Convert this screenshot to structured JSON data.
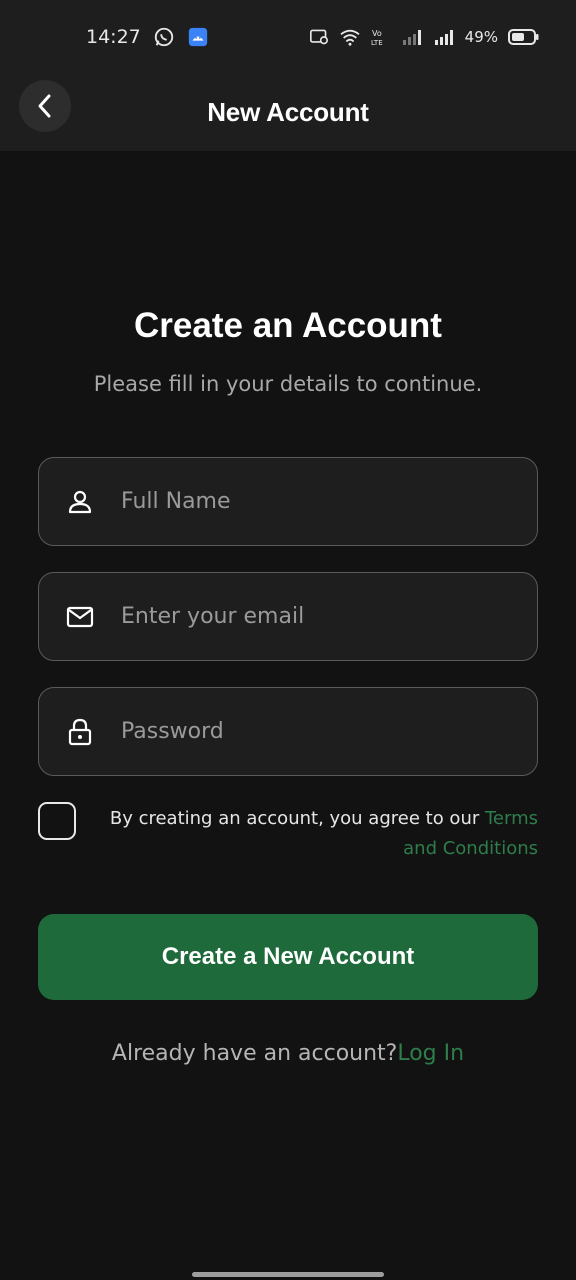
{
  "status_bar": {
    "time": "14:27",
    "battery_percent": "49%",
    "icons": [
      "whatsapp-icon",
      "android-app-icon",
      "cast-icon",
      "wifi-icon",
      "volte-icon",
      "signal-icon",
      "signal-icon",
      "battery-icon"
    ]
  },
  "header": {
    "title": "New Account",
    "back_icon": "chevron-left-icon"
  },
  "main": {
    "title": "Create an Account",
    "subtitle": "Please fill in your details to continue."
  },
  "form": {
    "full_name": {
      "placeholder": "Full Name",
      "value": "",
      "icon": "person-icon"
    },
    "email": {
      "placeholder": "Enter your email",
      "value": "",
      "icon": "mail-icon"
    },
    "password": {
      "placeholder": "Password",
      "value": "",
      "icon": "lock-icon"
    }
  },
  "terms": {
    "checked": false,
    "text": "By creating an account, you agree to our ",
    "link": "Terms and Conditions"
  },
  "submit_button": {
    "label": "Create a New Account"
  },
  "login": {
    "prompt": "Already have an account?",
    "link": "Log In"
  },
  "colors": {
    "background": "#121212",
    "surface": "#1e1e1e",
    "accent": "#1e6a3b",
    "link": "#2e7d4a"
  }
}
